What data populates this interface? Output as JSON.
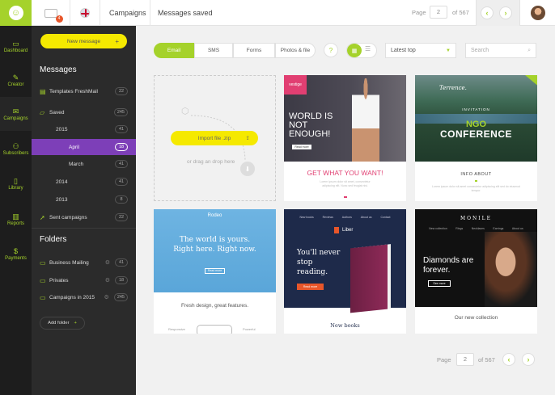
{
  "topbar": {
    "notification_count": "4",
    "breadcrumb_1": "Campaigns",
    "breadcrumb_2": "Messages saved",
    "page_label": "Page",
    "page_value": "2",
    "page_total": "of 567"
  },
  "nav": [
    {
      "label": "Dashboard",
      "icon": "monitor-icon"
    },
    {
      "label": "Creator",
      "icon": "pencil-icon"
    },
    {
      "label": "Campaigns",
      "icon": "envelope-icon"
    },
    {
      "label": "Subscribers",
      "icon": "users-icon"
    },
    {
      "label": "Library",
      "icon": "book-icon"
    },
    {
      "label": "Reports",
      "icon": "chart-icon"
    },
    {
      "label": "Payments",
      "icon": "dollar-icon"
    }
  ],
  "sidebar": {
    "new_message": "New message",
    "messages_title": "Messages",
    "messages": [
      {
        "label": "Templates FreshMail",
        "count": "22"
      },
      {
        "label": "Saved",
        "count": "245"
      },
      {
        "label": "2015",
        "count": "41"
      },
      {
        "label": "April",
        "count": "18"
      },
      {
        "label": "March",
        "count": "41"
      },
      {
        "label": "2014",
        "count": "41"
      },
      {
        "label": "2013",
        "count": "8"
      },
      {
        "label": "Sent campaigns",
        "count": "22"
      }
    ],
    "folders_title": "Folders",
    "folders": [
      {
        "label": "Business Mailing",
        "count": "41"
      },
      {
        "label": "Privates",
        "count": "18"
      },
      {
        "label": "Campaigns in 2015",
        "count": "245"
      }
    ],
    "add_folder": "Add folder"
  },
  "toolbar": {
    "tabs": [
      "Email",
      "SMS",
      "Forms",
      "Photos & file"
    ],
    "help": "?",
    "sort_value": "Latest top",
    "search_placeholder": "Search"
  },
  "cards": {
    "import": {
      "button": "Import file .zip",
      "hint": "or drag an drop here"
    },
    "vestige": {
      "brand": "vestige",
      "headline": "WORLD IS NOT ENOUGH!",
      "cta": "Read more",
      "title": "GET WHAT YOU WANT!",
      "body": "Lorem ipsum dolor sit amet, consectetur adipiscing elit. Nunc sed feugiat nisi."
    },
    "terrence": {
      "brand": "Terrence.",
      "invitation": "INVITATION",
      "headline1": "NGO",
      "headline2": "CONFERENCE",
      "info": "INFO ABOUT",
      "body": "Lorem ipsum dolor sit amet consectetur adipiscing elit sed do eiusmod tempor."
    },
    "rodeo": {
      "brand": "Rodeo",
      "headline1": "The world is yours.",
      "headline2": "Right here. Right now.",
      "cta": "Read more",
      "footer": "Fresh design, great features.",
      "left": "Responsive",
      "right": "Powerful"
    },
    "liber": {
      "nav": [
        "New books",
        "Reviews",
        "Authors",
        "About us",
        "Contact"
      ],
      "brand": "Liber",
      "headline": "You'll never stop reading.",
      "cta": "Read more",
      "footer": "New books"
    },
    "monile": {
      "brand": "MONILE",
      "nav": [
        "New collection",
        "Rings",
        "Necklaces",
        "Earrings",
        "About us"
      ],
      "headline": "Diamonds are forever.",
      "cta": "See more",
      "footer": "Our new collection"
    }
  },
  "bottom_pager": {
    "label": "Page",
    "value": "2",
    "total": "of 567"
  }
}
